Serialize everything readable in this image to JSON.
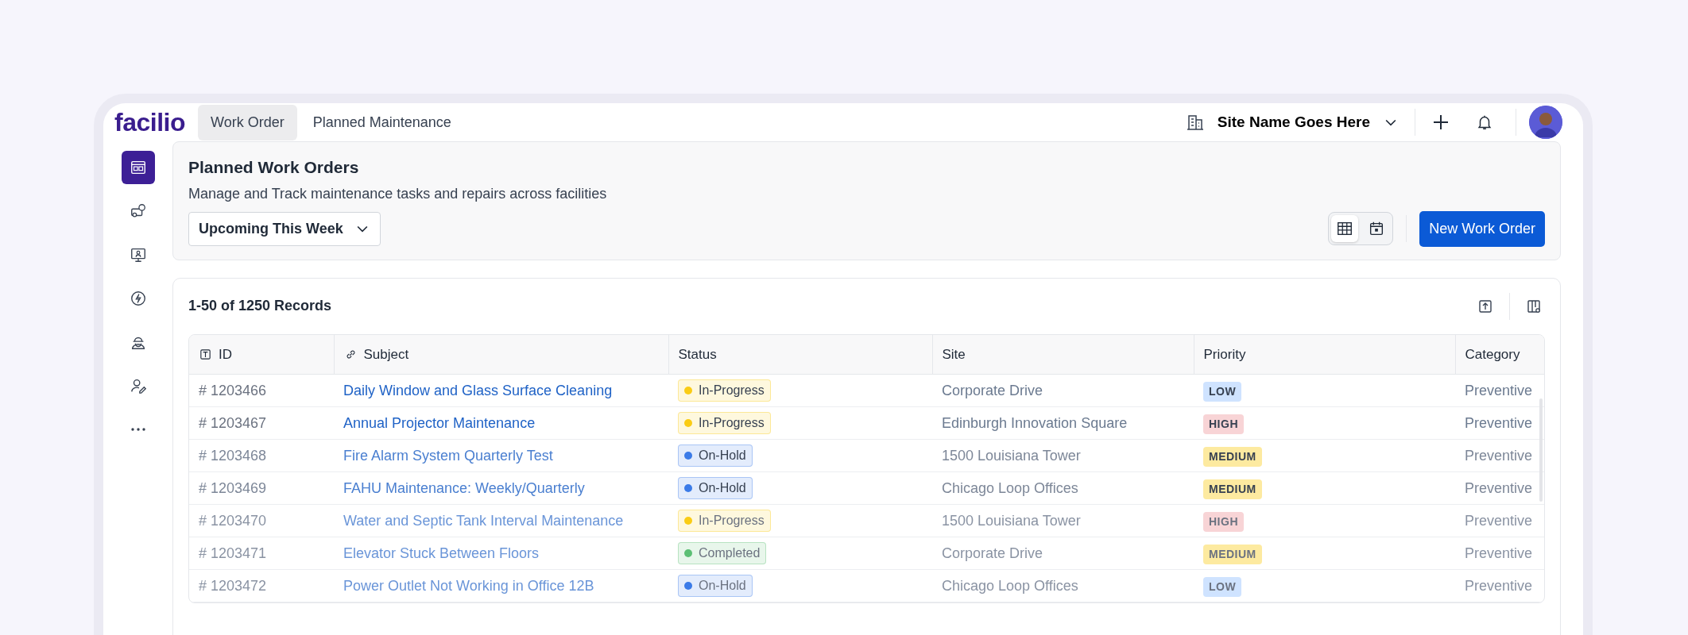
{
  "logo": "facilio",
  "tabs": [
    {
      "label": "Work Order",
      "selected": true
    },
    {
      "label": "Planned Maintenance",
      "selected": false
    }
  ],
  "site_selector": {
    "label": "Site Name Goes Here"
  },
  "sidebar": {
    "items": [
      {
        "selected": true
      },
      {
        "selected": false
      },
      {
        "selected": false
      },
      {
        "selected": false
      },
      {
        "selected": false
      },
      {
        "selected": false
      },
      {
        "selected": false
      }
    ]
  },
  "header": {
    "title": "Planned Work Orders",
    "subtitle": "Manage and Track maintenance tasks and repairs across facilities",
    "filter": "Upcoming This Week",
    "view_toggle": [
      {
        "selected": true
      },
      {
        "selected": false
      }
    ],
    "primary_button": "New Work Order"
  },
  "table": {
    "record_count": "1-50 of 1250 Records",
    "columns": [
      "ID",
      "Subject",
      "Status",
      "Site",
      "Priority",
      "Category"
    ],
    "rows": [
      {
        "id": "# 1203466",
        "subject": "Daily Window and Glass Surface Cleaning",
        "status": {
          "label": "In-Progress",
          "color": "#facc15"
        },
        "site": "Corporate Drive",
        "priority": {
          "label": "LOW",
          "color": "#cfe3ff"
        },
        "category": "Preventive"
      },
      {
        "id": "# 1203467",
        "subject": "Annual Projector Maintenance",
        "status": {
          "label": "In-Progress",
          "color": "#facc15"
        },
        "site": "Edinburgh Innovation Square",
        "priority": {
          "label": "HIGH",
          "color": "#f8d4d6"
        },
        "category": "Preventive"
      },
      {
        "id": "# 1203468",
        "subject": "Fire Alarm System Quarterly Test",
        "status": {
          "label": "On-Hold",
          "color": "#3b7be8"
        },
        "site": "1500 Louisiana Tower",
        "priority": {
          "label": "MEDIUM",
          "color": "#fdeaa0"
        },
        "category": "Preventive"
      },
      {
        "id": "# 1203469",
        "subject": "FAHU Maintenance: Weekly/Quarterly",
        "status": {
          "label": "On-Hold",
          "color": "#3b7be8"
        },
        "site": "Chicago Loop Offices",
        "priority": {
          "label": "MEDIUM",
          "color": "#fdeaa0"
        },
        "category": "Preventive"
      },
      {
        "id": "# 1203470",
        "subject": "Water and Septic Tank Interval Maintenance",
        "status": {
          "label": "In-Progress",
          "color": "#facc15"
        },
        "site": "1500 Louisiana Tower",
        "priority": {
          "label": "HIGH",
          "color": "#f8d4d6"
        },
        "category": "Preventive"
      },
      {
        "id": "# 1203471",
        "subject": "Elevator Stuck Between Floors",
        "status": {
          "label": "Completed",
          "color": "#5cbf74"
        },
        "site": "Corporate Drive",
        "priority": {
          "label": "MEDIUM",
          "color": "#fdeaa0"
        },
        "category": "Preventive"
      },
      {
        "id": "# 1203472",
        "subject": "Power Outlet Not Working in Office 12B",
        "status": {
          "label": "On-Hold",
          "color": "#3b7be8"
        },
        "site": "Chicago Loop Offices",
        "priority": {
          "label": "LOW",
          "color": "#cfe3ff"
        },
        "category": "Preventive"
      }
    ]
  }
}
